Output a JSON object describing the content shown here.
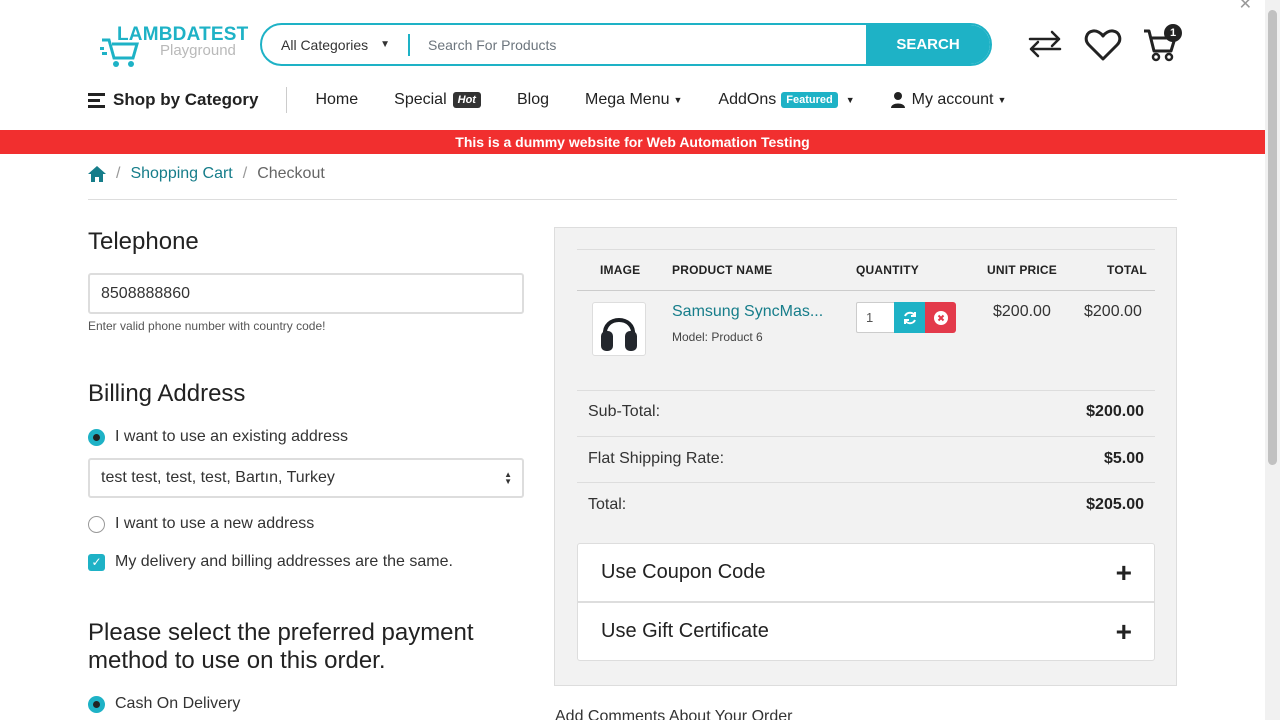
{
  "header": {
    "logo_main": "LAMBDATEST",
    "logo_sub": "Playground",
    "category_select": "All Categories",
    "search_placeholder": "Search For Products",
    "search_button": "SEARCH",
    "cart_count": "1"
  },
  "nav": {
    "shop_by_category": "Shop by Category",
    "items": [
      {
        "label": "Home"
      },
      {
        "label": "Special",
        "badge": "Hot"
      },
      {
        "label": "Blog"
      },
      {
        "label": "Mega Menu"
      },
      {
        "label": "AddOns",
        "badge": "Featured"
      },
      {
        "label": "My account"
      }
    ]
  },
  "banner": "This is a dummy website for Web Automation Testing",
  "breadcrumb": {
    "shopping_cart": "Shopping Cart",
    "current": "Checkout"
  },
  "telephone": {
    "heading": "Telephone",
    "value": "8508888860",
    "hint": "Enter valid phone number with country code!"
  },
  "billing": {
    "heading": "Billing Address",
    "existing_label": "I want to use an existing address",
    "selected_address": "test test, test, test, Bartın, Turkey",
    "new_label": "I want to use a new address",
    "same_label": "My delivery and billing addresses are the same."
  },
  "payment": {
    "heading_line1": "Please select the preferred payment",
    "heading_line2": "method to use on this order.",
    "option": "Cash On Delivery"
  },
  "cart": {
    "headers": {
      "image": "IMAGE",
      "name": "PRODUCT NAME",
      "quantity": "QUANTITY",
      "unit_price": "UNIT PRICE",
      "total": "TOTAL"
    },
    "item": {
      "name": "Samsung SyncMas...",
      "model": "Model: Product 6",
      "quantity": "1",
      "unit_price": "$200.00",
      "total": "$200.00"
    },
    "subtotal_label": "Sub-Total:",
    "subtotal": "$200.00",
    "shipping_label": "Flat Shipping Rate:",
    "shipping": "$5.00",
    "total_label": "Total:",
    "total": "$205.00"
  },
  "accordions": {
    "coupon": "Use Coupon Code",
    "gift": "Use Gift Certificate"
  },
  "comments_label": "Add Comments About Your Order",
  "colors": {
    "accent": "#1eb2c6",
    "banner": "#f12f2f",
    "danger": "#e33a4b"
  }
}
